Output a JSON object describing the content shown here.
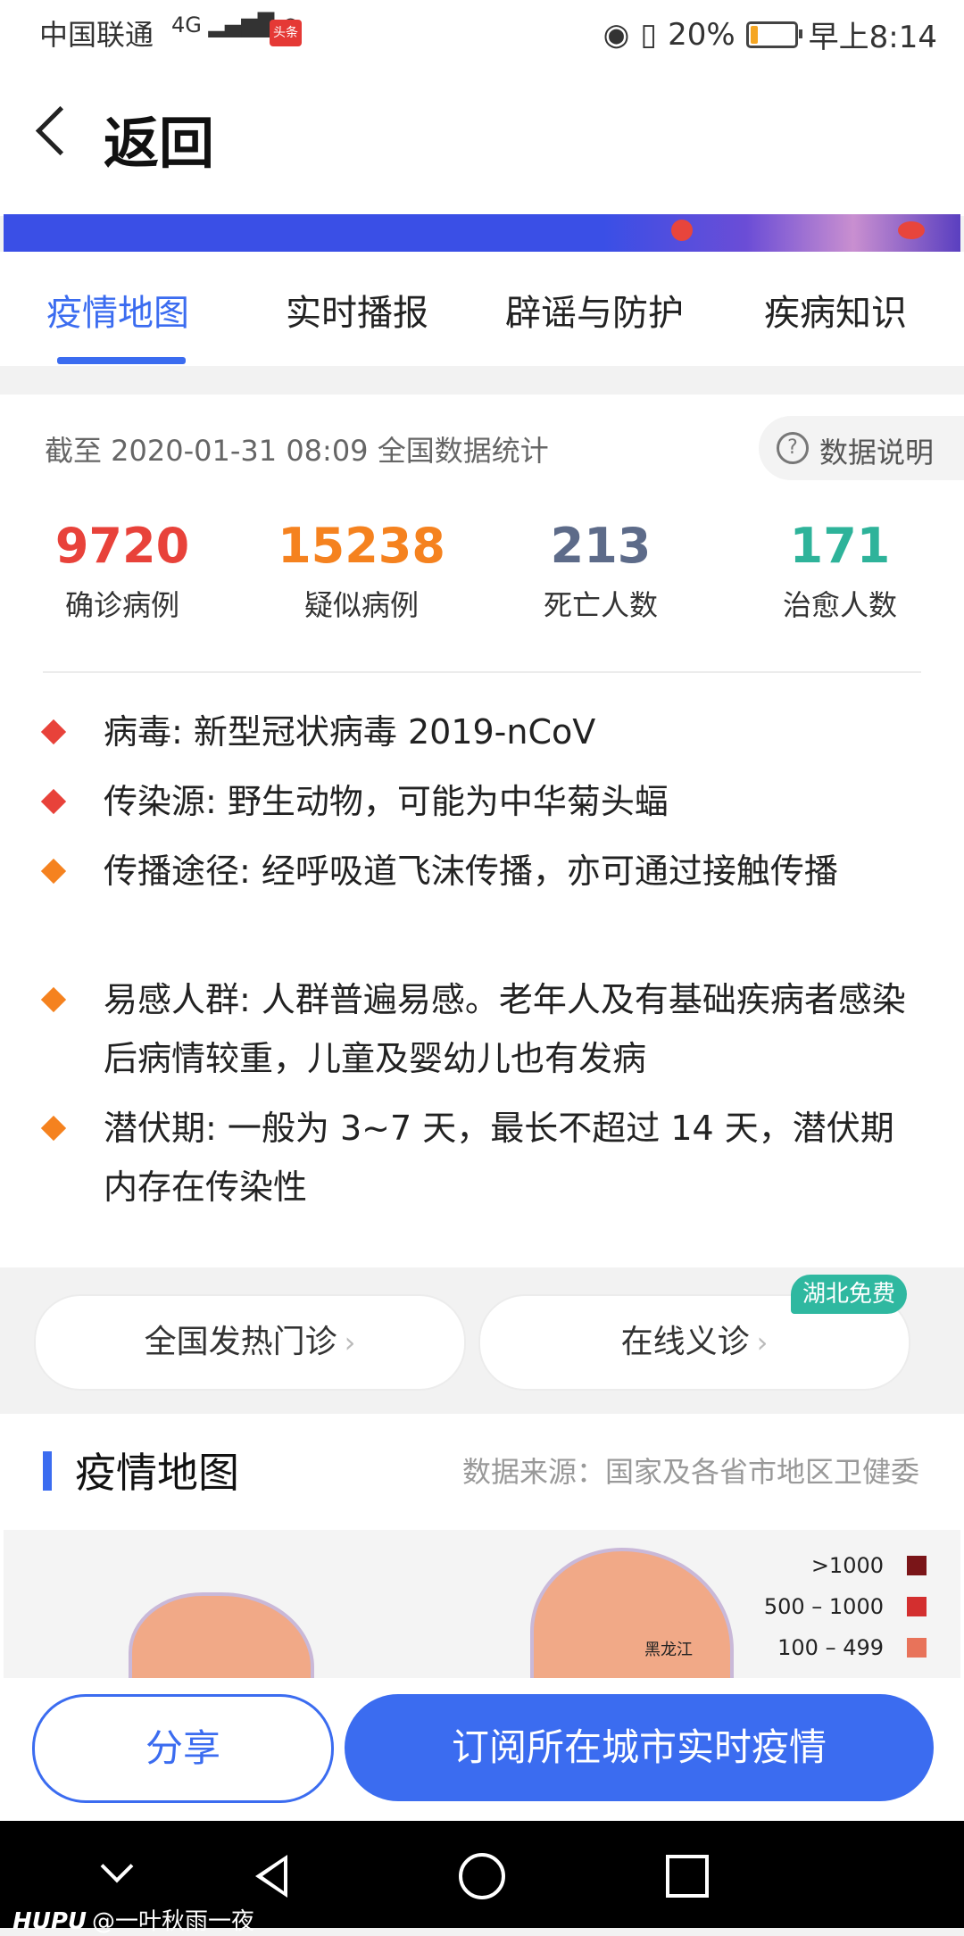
{
  "status_bar": {
    "carrier": "中国联通",
    "network": "4G",
    "app_badge": "头条",
    "battery_text": "20%",
    "battery_level": 0.2,
    "time": "早上8:14"
  },
  "header": {
    "back_label": "返回"
  },
  "tabs": [
    {
      "label": "疫情地图",
      "active": true
    },
    {
      "label": "实时播报",
      "active": false
    },
    {
      "label": "辟谣与防护",
      "active": false
    },
    {
      "label": "疾病知识",
      "active": false
    }
  ],
  "summary": {
    "updated": "截至 2020-01-31 08:09 全国数据统计",
    "data_note": "数据说明",
    "stats": [
      {
        "value": "9720",
        "label": "确诊病例",
        "color": "#e8423a"
      },
      {
        "value": "15238",
        "label": "疑似病例",
        "color": "#f5821f"
      },
      {
        "value": "213",
        "label": "死亡人数",
        "color": "#5d6b89"
      },
      {
        "value": "171",
        "label": "治愈人数",
        "color": "#2eb39a"
      }
    ],
    "info": [
      {
        "text": "病毒: 新型冠状病毒 2019-nCoV",
        "bullet_color": "#e8423a"
      },
      {
        "text": "传染源: 野生动物，可能为中华菊头蝠",
        "bullet_color": "#e8423a"
      },
      {
        "text": "传播途径: 经呼吸道飞沫传播，亦可通过接触传播",
        "bullet_color": "#f5821f"
      },
      {
        "text": "易感人群: 人群普遍易感。老年人及有基础疾病者感染后病情较重，儿童及婴幼儿也有发病",
        "bullet_color": "#f5821f"
      },
      {
        "text": "潜伏期: 一般为 3~7 天，最长不超过 14 天，潜伏期内存在传染性",
        "bullet_color": "#f5821f"
      }
    ]
  },
  "services": {
    "fever_clinic": "全国发热门诊",
    "online_consult": "在线义诊",
    "badge": "湖北免费"
  },
  "map": {
    "title": "疫情地图",
    "source": "数据来源：国家及各省市地区卫健委",
    "province_label": "黑龙江",
    "legend": [
      {
        "label": ">1000",
        "color": "#7a1518"
      },
      {
        "label": "500 – 1000",
        "color": "#d32f2f"
      },
      {
        "label": "100 – 499",
        "color": "#e8735a"
      }
    ]
  },
  "actions": {
    "share": "分享",
    "subscribe": "订阅所在城市实时疫情"
  },
  "watermark": {
    "brand": "HUPU",
    "handle": "@一叶秋雨一夜"
  }
}
